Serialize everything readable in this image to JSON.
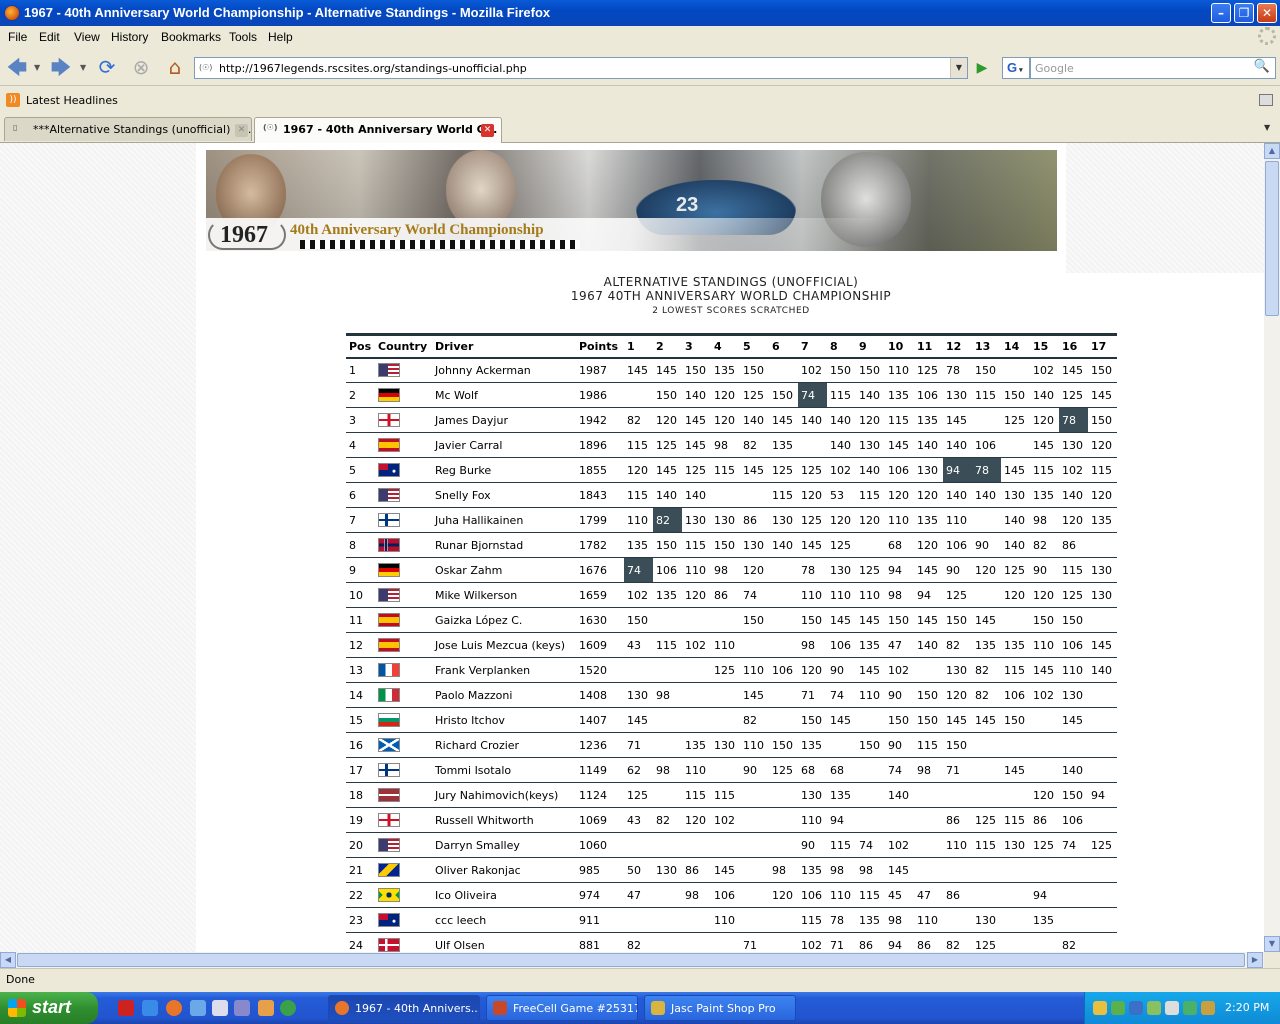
{
  "window": {
    "title": "1967 - 40th Anniversary World Championship - Alternative Standings - Mozilla Firefox"
  },
  "menu": [
    "File",
    "Edit",
    "View",
    "History",
    "Bookmarks",
    "Tools",
    "Help"
  ],
  "nav": {
    "url": "http://1967legends.rscsites.org/standings-unofficial.php",
    "search_placeholder": "Google",
    "search_engine": "G"
  },
  "bookmarks": {
    "item": "Latest Headlines"
  },
  "tabs": [
    {
      "label": "***Alternative Standings (unofficial) 1...",
      "active": false
    },
    {
      "label": "1967 - 40th Anniversary World C...",
      "active": true
    }
  ],
  "banner": {
    "year": "1967",
    "text": "40th Anniversary World Championship",
    "car_number": "23"
  },
  "page": {
    "heading_line1": "ALTERNATIVE STANDINGS (UNOFFICIAL)",
    "heading_line2": "1967 40TH ANNIVERSARY WORLD CHAMPIONSHIP",
    "subheading": "2 LOWEST SCORES SCRATCHED"
  },
  "table": {
    "headers": [
      "Pos",
      "Country",
      "Driver",
      "Points",
      "1",
      "2",
      "3",
      "4",
      "5",
      "6",
      "7",
      "8",
      "9",
      "10",
      "11",
      "12",
      "13",
      "14",
      "15",
      "16",
      "17"
    ],
    "rows": [
      {
        "pos": "1",
        "flag": "usa",
        "driver": "Johnny Ackerman",
        "points": "1987",
        "races": [
          "145",
          "145",
          "150",
          "135",
          "150",
          "",
          "102",
          "150",
          "150",
          "110",
          "125",
          "78",
          "150",
          "",
          "102",
          "145",
          "150"
        ],
        "hl": []
      },
      {
        "pos": "2",
        "flag": "germany",
        "driver": "Mc Wolf",
        "points": "1986",
        "races": [
          "",
          "150",
          "140",
          "120",
          "125",
          "150",
          "74",
          "115",
          "140",
          "135",
          "106",
          "130",
          "115",
          "150",
          "140",
          "125",
          "145"
        ],
        "hl": [
          6
        ]
      },
      {
        "pos": "3",
        "flag": "england",
        "driver": "James Dayjur",
        "points": "1942",
        "races": [
          "82",
          "120",
          "145",
          "120",
          "140",
          "145",
          "140",
          "140",
          "120",
          "115",
          "135",
          "145",
          "",
          "125",
          "120",
          "78",
          "150"
        ],
        "hl": [
          15
        ]
      },
      {
        "pos": "4",
        "flag": "spain",
        "driver": "Javier Carral",
        "points": "1896",
        "races": [
          "115",
          "125",
          "145",
          "98",
          "82",
          "135",
          "",
          "140",
          "130",
          "145",
          "140",
          "140",
          "106",
          "",
          "145",
          "130",
          "120"
        ],
        "hl": []
      },
      {
        "pos": "5",
        "flag": "australia",
        "driver": "Reg Burke",
        "points": "1855",
        "races": [
          "120",
          "145",
          "125",
          "115",
          "145",
          "125",
          "125",
          "102",
          "140",
          "106",
          "130",
          "94",
          "78",
          "145",
          "115",
          "102",
          "115"
        ],
        "hl": [
          11,
          12
        ]
      },
      {
        "pos": "6",
        "flag": "usa",
        "driver": "Snelly Fox",
        "points": "1843",
        "races": [
          "115",
          "140",
          "140",
          "",
          "",
          "115",
          "120",
          "53",
          "115",
          "120",
          "120",
          "140",
          "140",
          "130",
          "135",
          "140",
          "120"
        ],
        "hl": []
      },
      {
        "pos": "7",
        "flag": "finland",
        "driver": "Juha Hallikainen",
        "points": "1799",
        "races": [
          "110",
          "82",
          "130",
          "130",
          "86",
          "130",
          "125",
          "120",
          "120",
          "110",
          "135",
          "110",
          "",
          "140",
          "98",
          "120",
          "135"
        ],
        "hl": [
          1
        ]
      },
      {
        "pos": "8",
        "flag": "norway",
        "driver": "Runar Bjornstad",
        "points": "1782",
        "races": [
          "135",
          "150",
          "115",
          "150",
          "130",
          "140",
          "145",
          "125",
          "",
          "68",
          "120",
          "106",
          "90",
          "140",
          "82",
          "86",
          ""
        ],
        "hl": []
      },
      {
        "pos": "9",
        "flag": "germany",
        "driver": "Oskar Zahm",
        "points": "1676",
        "races": [
          "74",
          "106",
          "110",
          "98",
          "120",
          "",
          "78",
          "130",
          "125",
          "94",
          "145",
          "90",
          "120",
          "125",
          "90",
          "115",
          "130"
        ],
        "hl": [
          0
        ]
      },
      {
        "pos": "10",
        "flag": "usa",
        "driver": "Mike Wilkerson",
        "points": "1659",
        "races": [
          "102",
          "135",
          "120",
          "86",
          "74",
          "",
          "110",
          "110",
          "110",
          "98",
          "94",
          "125",
          "",
          "120",
          "120",
          "125",
          "130"
        ],
        "hl": []
      },
      {
        "pos": "11",
        "flag": "spain",
        "driver": "Gaizka López C.",
        "points": "1630",
        "races": [
          "150",
          "",
          "",
          "",
          "150",
          "",
          "150",
          "145",
          "145",
          "150",
          "145",
          "150",
          "145",
          "",
          "150",
          "150",
          ""
        ],
        "hl": []
      },
      {
        "pos": "12",
        "flag": "spain",
        "driver": "Jose Luis Mezcua (keys)",
        "points": "1609",
        "races": [
          "43",
          "115",
          "102",
          "110",
          "",
          "",
          "98",
          "106",
          "135",
          "47",
          "140",
          "82",
          "135",
          "135",
          "110",
          "106",
          "145"
        ],
        "hl": []
      },
      {
        "pos": "13",
        "flag": "france",
        "driver": "Frank Verplanken",
        "points": "1520",
        "races": [
          "",
          "",
          "",
          "125",
          "110",
          "106",
          "120",
          "90",
          "145",
          "102",
          "",
          "130",
          "82",
          "115",
          "145",
          "110",
          "140"
        ],
        "hl": []
      },
      {
        "pos": "14",
        "flag": "italy",
        "driver": "Paolo Mazzoni",
        "points": "1408",
        "races": [
          "130",
          "98",
          "",
          "",
          "145",
          "",
          "71",
          "74",
          "110",
          "90",
          "150",
          "120",
          "82",
          "106",
          "102",
          "130",
          ""
        ],
        "hl": []
      },
      {
        "pos": "15",
        "flag": "bulgaria",
        "driver": "Hristo Itchov",
        "points": "1407",
        "races": [
          "145",
          "",
          "",
          "",
          "82",
          "",
          "150",
          "145",
          "",
          "150",
          "150",
          "145",
          "145",
          "150",
          "",
          "145",
          ""
        ],
        "hl": []
      },
      {
        "pos": "16",
        "flag": "scotland",
        "driver": "Richard Crozier",
        "points": "1236",
        "races": [
          "71",
          "",
          "135",
          "130",
          "110",
          "150",
          "135",
          "",
          "150",
          "90",
          "115",
          "150",
          "",
          "",
          "",
          "",
          ""
        ],
        "hl": []
      },
      {
        "pos": "17",
        "flag": "finland",
        "driver": "Tommi Isotalo",
        "points": "1149",
        "races": [
          "62",
          "98",
          "110",
          "",
          "90",
          "125",
          "68",
          "68",
          "",
          "74",
          "98",
          "71",
          "",
          "145",
          "",
          "140",
          ""
        ],
        "hl": []
      },
      {
        "pos": "18",
        "flag": "latvia",
        "driver": "Jury Nahimovich(keys)",
        "points": "1124",
        "races": [
          "125",
          "",
          "115",
          "115",
          "",
          "",
          "130",
          "135",
          "",
          "140",
          "",
          "",
          "",
          "",
          "120",
          "150",
          "94"
        ],
        "hl": []
      },
      {
        "pos": "19",
        "flag": "england",
        "driver": "Russell Whitworth",
        "points": "1069",
        "races": [
          "43",
          "82",
          "120",
          "102",
          "",
          "",
          "110",
          "94",
          "",
          "",
          "",
          "86",
          "125",
          "115",
          "86",
          "106",
          ""
        ],
        "hl": []
      },
      {
        "pos": "20",
        "flag": "usa",
        "driver": "Darryn Smalley",
        "points": "1060",
        "races": [
          "",
          "",
          "",
          "",
          "",
          "",
          "90",
          "115",
          "74",
          "102",
          "",
          "110",
          "115",
          "130",
          "125",
          "74",
          "125"
        ],
        "hl": []
      },
      {
        "pos": "21",
        "flag": "bosnia",
        "driver": "Oliver Rakonjac",
        "points": "985",
        "races": [
          "50",
          "130",
          "86",
          "145",
          "",
          "98",
          "135",
          "98",
          "98",
          "145",
          "",
          "",
          "",
          "",
          "",
          "",
          ""
        ],
        "hl": []
      },
      {
        "pos": "22",
        "flag": "brazil",
        "driver": "Ico Oliveira",
        "points": "974",
        "races": [
          "47",
          "",
          "98",
          "106",
          "",
          "120",
          "106",
          "110",
          "115",
          "45",
          "47",
          "86",
          "",
          "",
          "94",
          "",
          ""
        ],
        "hl": []
      },
      {
        "pos": "23",
        "flag": "australia",
        "driver": "ccc leech",
        "points": "911",
        "races": [
          "",
          "",
          "",
          "110",
          "",
          "",
          "115",
          "78",
          "135",
          "98",
          "110",
          "",
          "130",
          "",
          "135",
          "",
          ""
        ],
        "hl": []
      },
      {
        "pos": "24",
        "flag": "denmark",
        "driver": "Ulf Olsen",
        "points": "881",
        "races": [
          "82",
          "",
          "",
          "",
          "71",
          "",
          "102",
          "71",
          "86",
          "94",
          "86",
          "82",
          "125",
          "",
          "",
          "82",
          ""
        ],
        "hl": []
      }
    ]
  },
  "status": {
    "text": "Done"
  },
  "taskbar": {
    "start": "start",
    "tasks": [
      "1967 - 40th Annivers...",
      "FreeCell Game #25317",
      "Jasc Paint Shop Pro"
    ],
    "clock": "2:20 PM"
  }
}
